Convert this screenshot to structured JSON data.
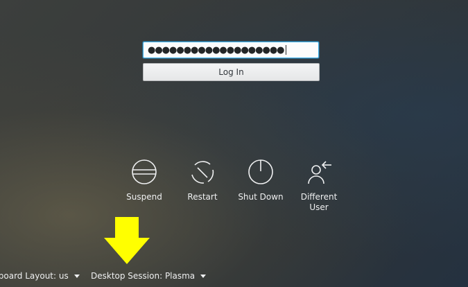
{
  "login": {
    "password_masked": "●●●●●●●●●●●●●●●●●●●",
    "login_label": "Log In"
  },
  "actions": [
    {
      "label": "Suspend",
      "icon": "suspend-icon"
    },
    {
      "label": "Restart",
      "icon": "restart-icon"
    },
    {
      "label": "Shut Down",
      "icon": "shutdown-icon"
    },
    {
      "label": "Different User",
      "line1": "Different",
      "line2": "User",
      "icon": "user-switch-icon"
    }
  ],
  "footer": {
    "keyboard_layout": "Keyboard Layout: us",
    "desktop_session": "Desktop Session: Plasma"
  },
  "colors": {
    "focus_border": "#3daee9",
    "annotation_arrow": "#ffff00",
    "text": "#eff0f1"
  }
}
